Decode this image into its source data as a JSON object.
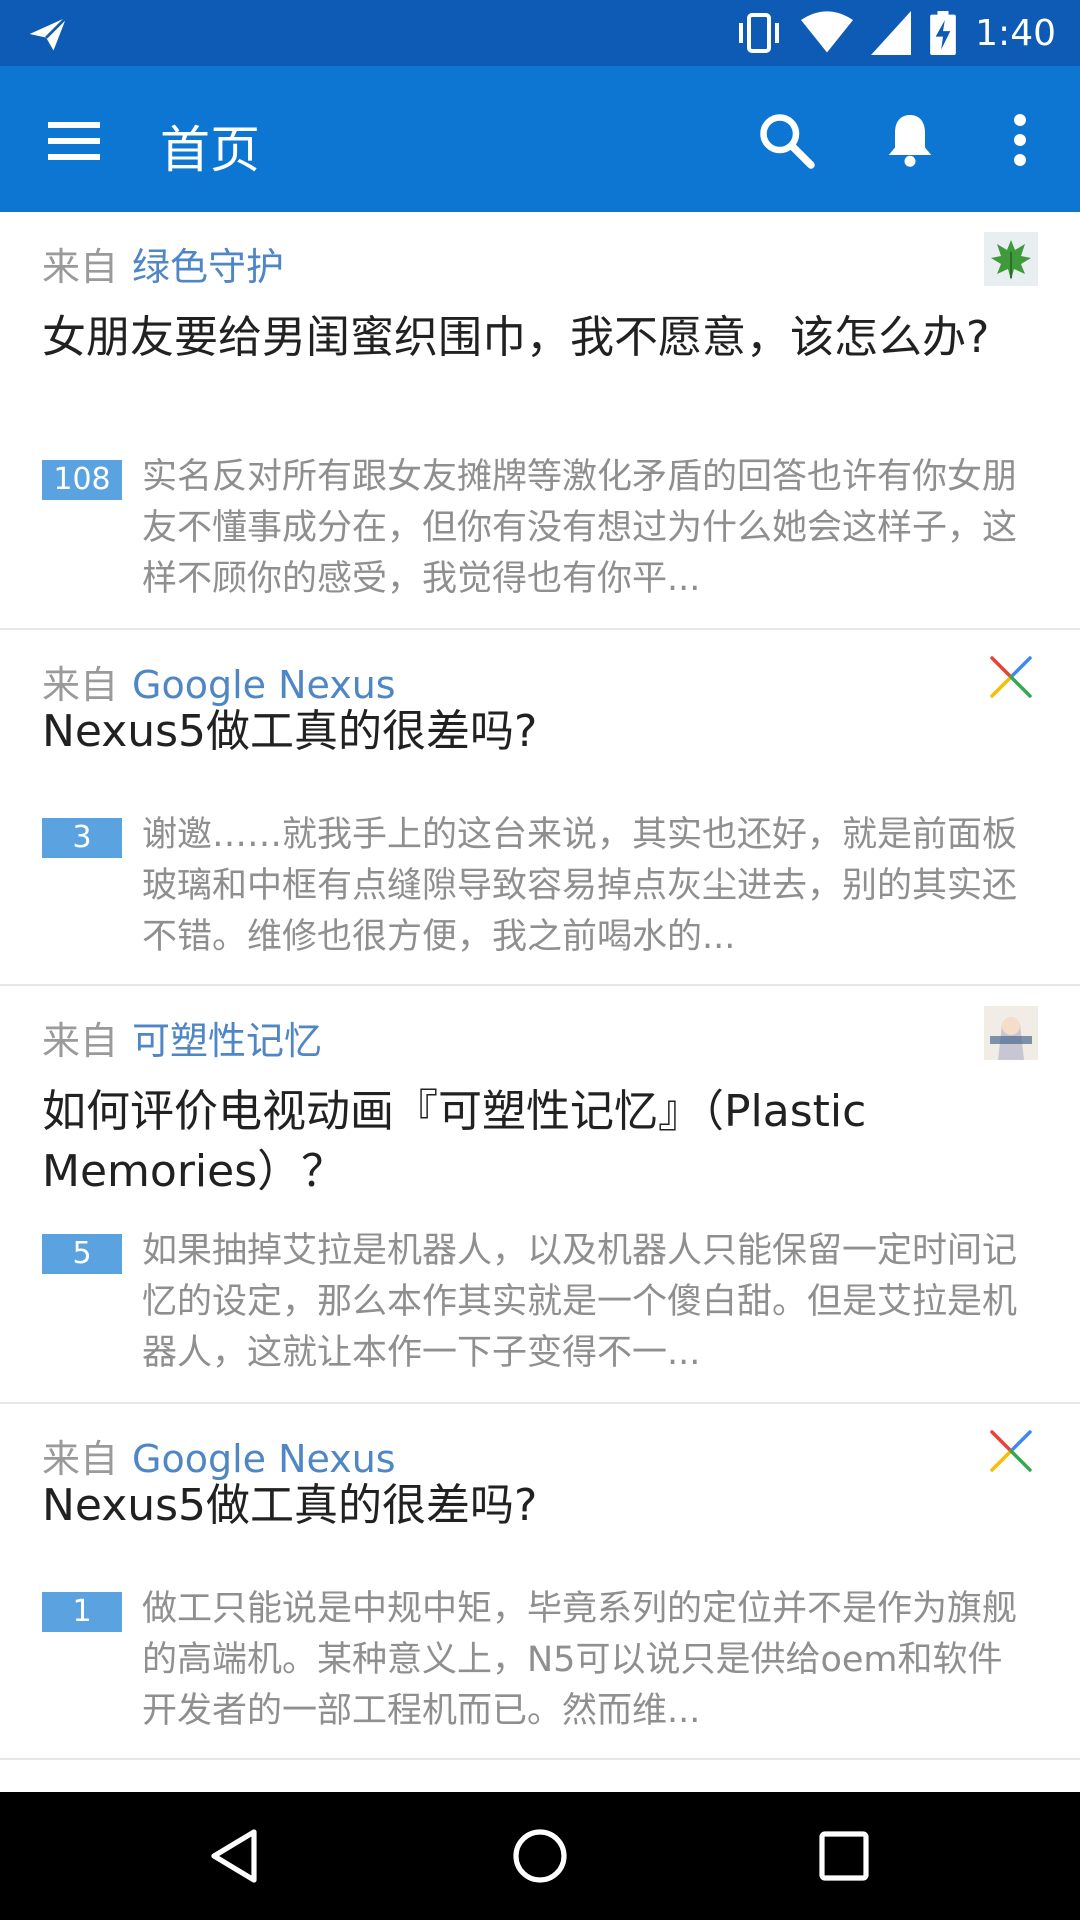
{
  "status_bar": {
    "time": "1:40",
    "icons": [
      "send-icon",
      "vibrate-icon",
      "wifi-icon",
      "signal-icon",
      "battery-charging-icon"
    ]
  },
  "app_bar": {
    "title": "首页",
    "icons": [
      "menu-icon",
      "search-icon",
      "bell-icon",
      "more-vert-icon"
    ],
    "color": "#0d76d3"
  },
  "feed": {
    "from_prefix": "来自",
    "items": [
      {
        "source": "绿色守护",
        "topic_icon": "leaf-icon",
        "title": "女朋友要给男闺蜜织围巾，我不愿意，该怎么办?",
        "votes": "108",
        "excerpt": "实名反对所有跟女友摊牌等激化矛盾的回答也许有你女朋友不懂事成分在，但你有没有想过为什么她会这样子，这样不顾你的感受，我觉得也有你平..."
      },
      {
        "source": "Google Nexus",
        "topic_icon": "nexus-x-icon",
        "title": "Nexus5做工真的很差吗?",
        "votes": "3",
        "excerpt": "谢邀……就我手上的这台来说，其实也还好，就是前面板玻璃和中框有点缝隙导致容易掉点灰尘进去，别的其实还不错。维修也很方便，我之前喝水的..."
      },
      {
        "source": "可塑性记忆",
        "topic_icon": "anime-cover-icon",
        "title": "如何评价电视动画『可塑性记忆』（Plastic Memories）？",
        "votes": "5",
        "excerpt": "如果抽掉艾拉是机器人，以及机器人只能保留一定时间记忆的设定，那么本作其实就是一个傻白甜。但是艾拉是机器人，这就让本作一下子变得不一..."
      },
      {
        "source": "Google Nexus",
        "topic_icon": "nexus-x-icon",
        "title": "Nexus5做工真的很差吗?",
        "votes": "1",
        "excerpt": "做工只能说是中规中矩，毕竟系列的定位并不是作为旗舰的高端机。某种意义上，N5可以说只是供给oem和软件开发者的一部工程机而已。然而维..."
      }
    ]
  },
  "nav_bar": {
    "icons": [
      "back-icon",
      "home-icon",
      "recents-icon"
    ]
  }
}
